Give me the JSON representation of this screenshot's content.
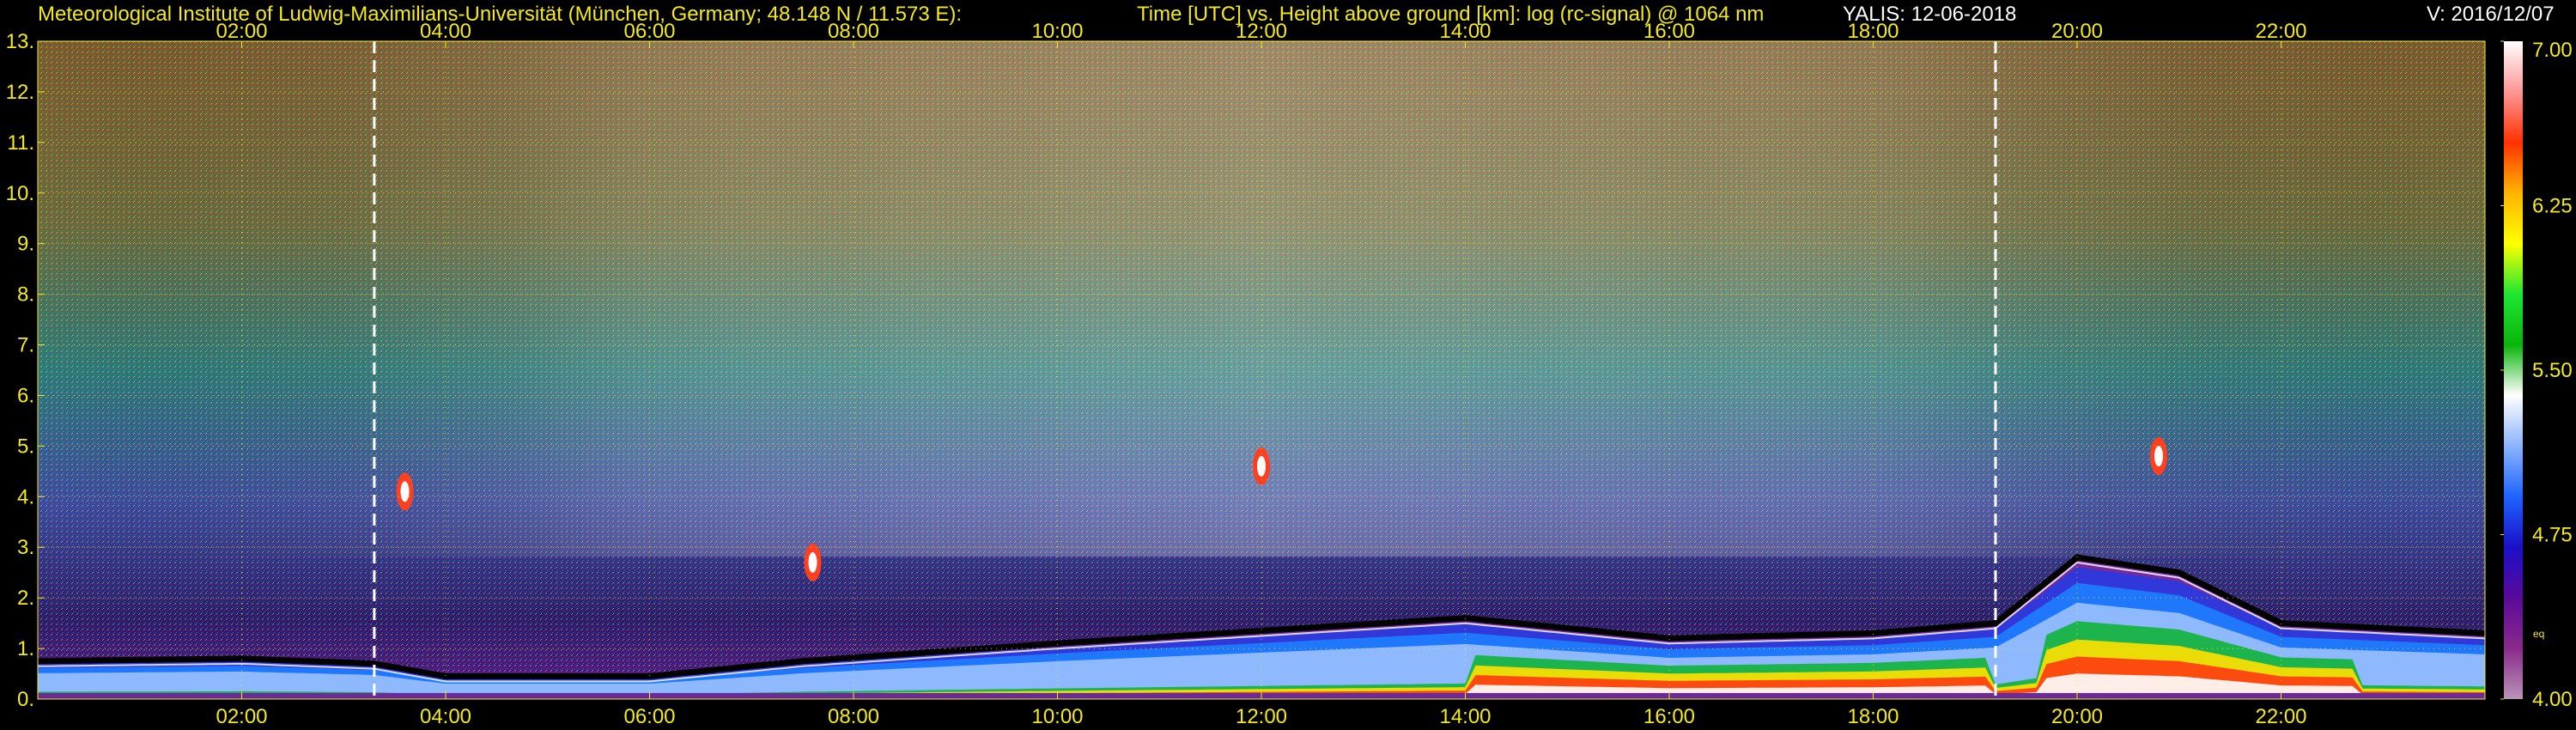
{
  "header": {
    "institute": "Meteorological Institute of Ludwig-Maximilians-Universität (München, Germany; 48.148 N / 11.573 E):",
    "title": "Time [UTC] vs. Height above ground [km]: log (rc-signal) @ 1064 nm",
    "instrument_date": "YALIS: 12-06-2018",
    "version": "V: 2016/12/07"
  },
  "colorbar": {
    "tick_labels": [
      "7.00",
      "6.25",
      "5.50",
      "4.75",
      "4.00"
    ],
    "ticks": [
      7.0,
      6.25,
      5.5,
      4.75,
      4.0
    ],
    "range": [
      4.0,
      7.0
    ],
    "unit_label": "eq",
    "colors": [
      "#b894b8",
      "#8a2a8a",
      "#5a0a9a",
      "#1a10c8",
      "#1e64ff",
      "#8cb4ff",
      "#ffffff",
      "#0ab40a",
      "#1ee632",
      "#ffff00",
      "#ffb400",
      "#ff3200",
      "#ff9696",
      "#ffffff"
    ]
  },
  "chart_data": {
    "type": "heatmap",
    "title": "Time [UTC] vs. Height above ground [km]: log (rc-signal) @ 1064 nm",
    "x_axis": {
      "label": "Time [UTC]",
      "range": [
        0,
        24
      ],
      "tick_values": [
        2,
        4,
        6,
        8,
        10,
        12,
        14,
        16,
        18,
        20,
        22
      ],
      "tick_labels": [
        "02:00",
        "04:00",
        "06:00",
        "08:00",
        "10:00",
        "12:00",
        "14:00",
        "16:00",
        "18:00",
        "20:00",
        "22:00"
      ]
    },
    "y_axis": {
      "label": "Height above ground [km]",
      "range": [
        0,
        13
      ],
      "tick_values": [
        0,
        1,
        2,
        3,
        4,
        5,
        6,
        7,
        8,
        9,
        10,
        11,
        12,
        13
      ],
      "tick_labels": [
        "0.",
        "1.",
        "2.",
        "3.",
        "4.",
        "5.",
        "6.",
        "7.",
        "8.",
        "9.",
        "10.",
        "11.",
        "12.",
        "13."
      ]
    },
    "grid": true,
    "gaps_utc": [
      3.3,
      19.2
    ],
    "boundary_layer_top_km": [
      {
        "t": 0.0,
        "h": 0.75
      },
      {
        "t": 2.0,
        "h": 0.8
      },
      {
        "t": 3.3,
        "h": 0.7
      },
      {
        "t": 4.0,
        "h": 0.45
      },
      {
        "t": 6.0,
        "h": 0.45
      },
      {
        "t": 7.5,
        "h": 0.75
      },
      {
        "t": 10.0,
        "h": 1.1
      },
      {
        "t": 12.0,
        "h": 1.35
      },
      {
        "t": 14.0,
        "h": 1.6
      },
      {
        "t": 16.0,
        "h": 1.2
      },
      {
        "t": 18.0,
        "h": 1.3
      },
      {
        "t": 19.2,
        "h": 1.5
      },
      {
        "t": 20.0,
        "h": 2.8
      },
      {
        "t": 21.0,
        "h": 2.5
      },
      {
        "t": 22.0,
        "h": 1.5
      },
      {
        "t": 24.0,
        "h": 1.3
      }
    ],
    "cloud_features": [
      {
        "t": 12.0,
        "h": 4.6
      },
      {
        "t": 20.8,
        "h": 4.8
      },
      {
        "t": 7.6,
        "h": 2.7
      },
      {
        "t": 3.6,
        "h": 4.1
      }
    ]
  }
}
